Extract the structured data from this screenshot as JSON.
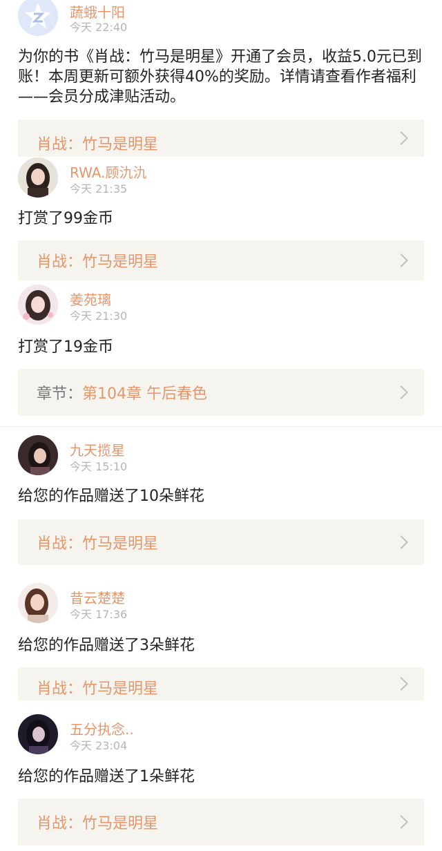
{
  "notifications": [
    {
      "name": "蔬蛾十阳",
      "time": "今天 22:40",
      "message": "为你的书《肖战：竹马是明星》开通了会员，收益5.0元已到账！本周更新可额外获得40%的奖励。详情请查看作者福利——会员分成津贴活动。",
      "card_label": "",
      "card_title": "肖战：竹马是明星",
      "avatar_icon": "system-logo-icon"
    },
    {
      "name": "RWA.顾氿氿",
      "time": "今天 21:35",
      "message": "打赏了99金币",
      "card_label": "",
      "card_title": "肖战：竹马是明星",
      "avatar_icon": "user-avatar"
    },
    {
      "name": "姜苑璃",
      "time": "今天 21:30",
      "message": "打赏了19金币",
      "card_label": "章节：",
      "card_title": "第104章 午后春色",
      "avatar_icon": "user-avatar"
    },
    {
      "name": "九天揽星",
      "time": "今天 15:10",
      "message": "给您的作品赠送了10朵鲜花",
      "card_label": "",
      "card_title": "肖战：竹马是明星",
      "avatar_icon": "user-avatar"
    },
    {
      "name": "昔云楚楚",
      "time": "今天 17:36",
      "message": "给您的作品赠送了3朵鲜花",
      "card_label": "",
      "card_title": "肖战：竹马是明星",
      "avatar_icon": "user-avatar"
    },
    {
      "name": "五分执念..",
      "time": "今天 23:04",
      "message": "给您的作品赠送了1朵鲜花",
      "card_label": "",
      "card_title": "肖战：竹马是明星",
      "avatar_icon": "user-avatar"
    }
  ],
  "colors": {
    "accent": "#e8956a",
    "card_bg": "#f5f4ef",
    "time": "#b5b5b5"
  }
}
